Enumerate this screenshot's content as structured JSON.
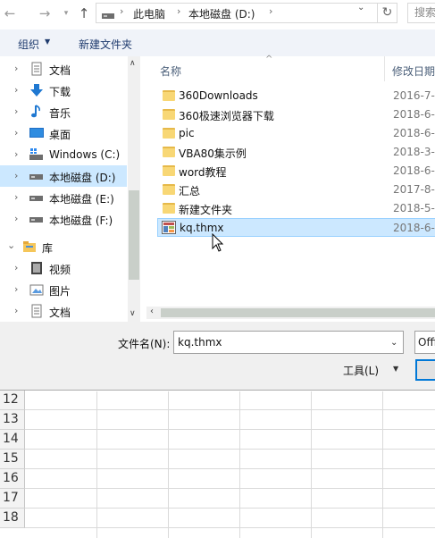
{
  "address_bar": {
    "crumbs": [
      "此电脑",
      "本地磁盘 (D:)"
    ],
    "search_placeholder": "搜索"
  },
  "toolbar": {
    "organize": "组织",
    "new_folder": "新建文件夹"
  },
  "nav": {
    "items": [
      {
        "label": "文档",
        "icon": "documents-icon"
      },
      {
        "label": "下载",
        "icon": "download-icon"
      },
      {
        "label": "音乐",
        "icon": "music-icon"
      },
      {
        "label": "桌面",
        "icon": "desktop-icon"
      },
      {
        "label": "Windows (C:)",
        "icon": "windows-drive-icon"
      },
      {
        "label": "本地磁盘 (D:)",
        "icon": "drive-icon"
      },
      {
        "label": "本地磁盘 (E:)",
        "icon": "drive-icon"
      },
      {
        "label": "本地磁盘 (F:)",
        "icon": "drive-icon"
      },
      {
        "label": "库",
        "icon": "library-icon"
      },
      {
        "label": "视频",
        "icon": "video-icon"
      },
      {
        "label": "图片",
        "icon": "pictures-icon"
      },
      {
        "label": "文档",
        "icon": "documents-icon"
      }
    ]
  },
  "files": {
    "col_name": "名称",
    "col_date": "修改日期",
    "rows": [
      {
        "name": "360Downloads",
        "date": "2016-7-",
        "type": "folder"
      },
      {
        "name": "360极速浏览器下载",
        "date": "2018-6-",
        "type": "folder"
      },
      {
        "name": "pic",
        "date": "2018-6-",
        "type": "folder"
      },
      {
        "name": "VBA80集示例",
        "date": "2018-3-",
        "type": "folder"
      },
      {
        "name": "word教程",
        "date": "2018-6-",
        "type": "folder"
      },
      {
        "name": "汇总",
        "date": "2017-8-",
        "type": "folder"
      },
      {
        "name": "新建文件夹",
        "date": "2018-5-",
        "type": "folder"
      },
      {
        "name": "kq.thmx",
        "date": "2018-6-",
        "type": "thmx-file"
      }
    ]
  },
  "bottom": {
    "filename_label": "文件名(N):",
    "filename_value": "kq.thmx",
    "filetype_value": "Office",
    "tools_label": "工具(L)"
  },
  "sheet": {
    "row_numbers": [
      "12",
      "13",
      "14",
      "15",
      "16",
      "17",
      "18"
    ]
  },
  "colors": {
    "selection": "#cce8ff",
    "selection_border": "#99d1ff",
    "folder": "#f8d775",
    "link_blue": "#1f3b6e",
    "accent": "#0078d7"
  }
}
